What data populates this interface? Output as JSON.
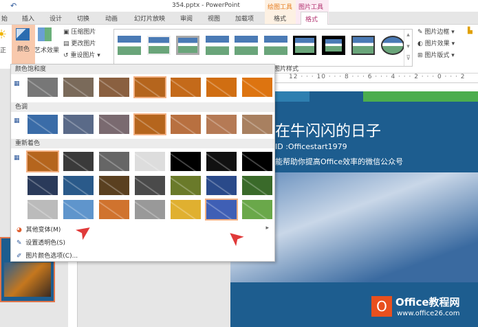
{
  "title": "354.pptx - PowerPoint",
  "context_tabs": [
    {
      "group": "绘图工具",
      "tab": "格式",
      "color": "#e67e22"
    },
    {
      "group": "图片工具",
      "tab": "格式",
      "color": "#b1306e"
    }
  ],
  "tabs": [
    "始",
    "插入",
    "设计",
    "切换",
    "动画",
    "幻灯片放映",
    "审阅",
    "视图",
    "加载项"
  ],
  "ribbon": {
    "correct": "正",
    "color": "颜色",
    "artistic": "艺术效果",
    "compress": "压缩图片",
    "change": "更改图片",
    "reset": "重设图片",
    "border": "图片边框",
    "effects": "图片效果",
    "layout": "图片版式",
    "styles_group": "图片样式"
  },
  "ruler": "12 · · · 10 · · · 8 · · · 6 · · · 4 · · · 2 · · · 0 · · · 2",
  "dropdown": {
    "sections": [
      "颜色饱和度",
      "色调",
      "重新着色"
    ],
    "saturation": [
      "#777",
      "#7a6a5a",
      "#8a6040",
      "#b5651d",
      "#c46a1a",
      "#d06e12",
      "#dd7410"
    ],
    "tone": [
      "#3a6ca8",
      "#5a6a88",
      "#7a6a70",
      "#b5651d",
      "#b87040",
      "#b57a55",
      "#a88060"
    ],
    "recolor": [
      [
        "#b5651d",
        "#3a3a3a",
        "#666",
        "#ddd",
        "#000",
        "#111",
        "#000"
      ],
      [
        "#2a3a5a",
        "#2a5a8a",
        "#5a4020",
        "#4a4a4a",
        "#6a7a2a",
        "#2a4a8a",
        "#3a6a2a"
      ],
      [
        "#bbb",
        "#5f95cc",
        "#d0732e",
        "#999",
        "#e0b030",
        "#3f5fb5",
        "#6aa84a"
      ]
    ],
    "menu": [
      "其他变体(M)",
      "设置透明色(S)",
      "图片颜色选项(C)..."
    ]
  },
  "slide": {
    "title": "在牛闪闪的日子",
    "id": "ID :Officestart1979",
    "subtitle": "能帮助你提高Office效率的微信公众号"
  },
  "watermark": {
    "brand": "Office教程网",
    "url": "www.office26.com"
  }
}
